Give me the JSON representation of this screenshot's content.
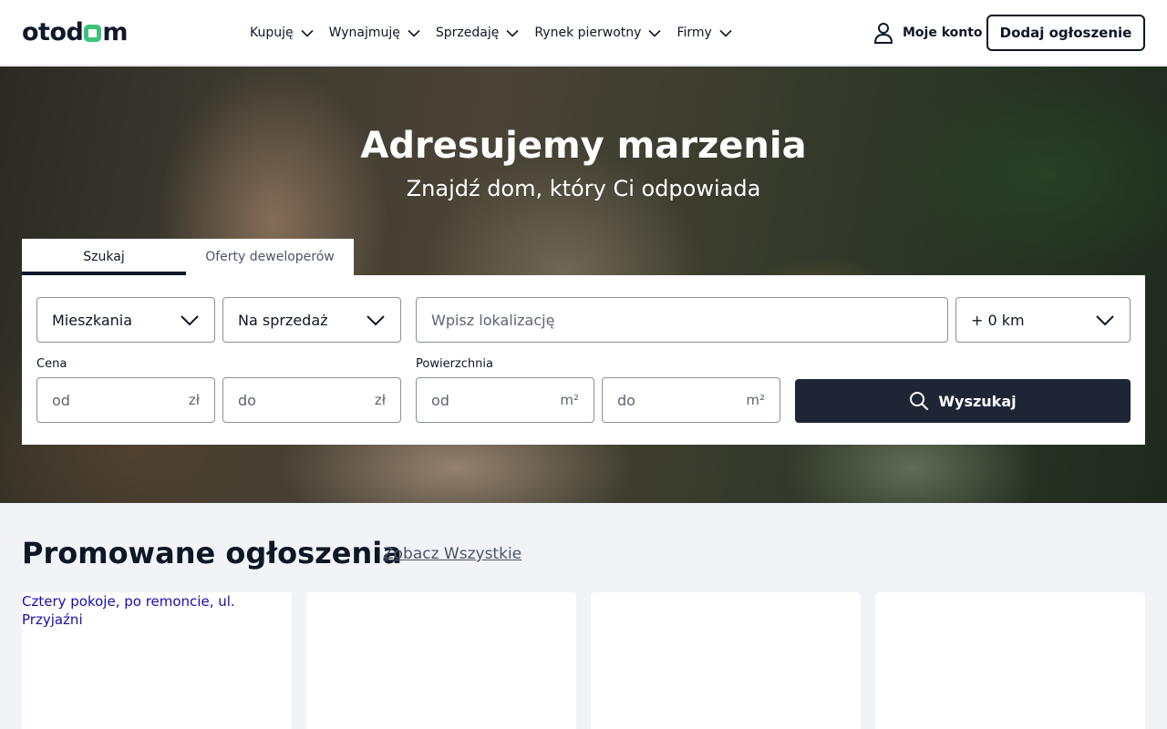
{
  "header": {
    "logo_left": "otod",
    "logo_right": "m",
    "nav": [
      {
        "label": "Kupuję"
      },
      {
        "label": "Wynajmuję"
      },
      {
        "label": "Sprzedaję"
      },
      {
        "label": "Rynek pierwotny"
      },
      {
        "label": "Firmy"
      }
    ],
    "account_label": "Moje konto",
    "add_listing_label": "Dodaj ogłoszenie"
  },
  "hero": {
    "title": "Adresujemy marzenia",
    "subtitle": "Znajdź dom, który Ci odpowiada"
  },
  "tabs": [
    {
      "label": "Szukaj",
      "active": true
    },
    {
      "label": "Oferty deweloperów",
      "active": false
    }
  ],
  "search": {
    "property_type": "Mieszkania",
    "transaction_type": "Na sprzedaż",
    "location_placeholder": "Wpisz lokalizację",
    "radius": "+ 0 km",
    "price_label": "Cena",
    "price_from_placeholder": "od",
    "price_to_placeholder": "do",
    "price_unit": "zł",
    "area_label": "Powierzchnia",
    "area_from_placeholder": "od",
    "area_to_placeholder": "do",
    "area_unit": "m²",
    "search_button": "Wyszukaj"
  },
  "promoted": {
    "title": "Promowane ogłoszenia",
    "see_all": "Zobacz Wszystkie",
    "cards": [
      {
        "image_alt": "Cztery pokoje, po remoncie, ul. Przyjaźni"
      },
      {
        "image_alt": ""
      },
      {
        "image_alt": ""
      },
      {
        "image_alt": ""
      }
    ]
  },
  "colors": {
    "brand_green": "#3ec27a",
    "dark_navy": "#1e2636",
    "text": "#0e1726"
  }
}
